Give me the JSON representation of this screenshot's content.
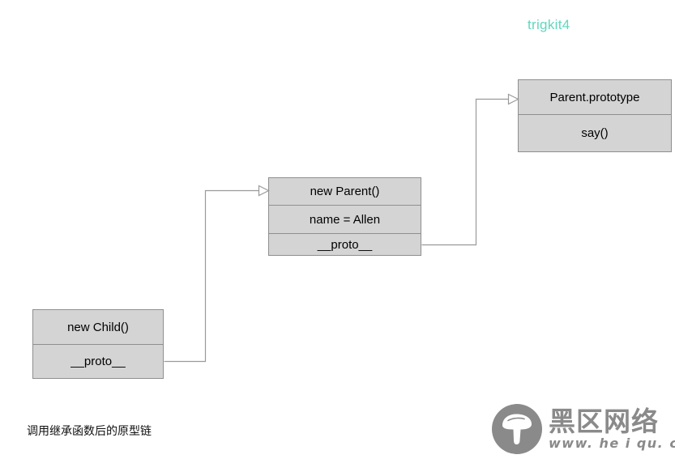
{
  "watermark_top": {
    "text": "trigkit4",
    "color": "#5fd8bd"
  },
  "diagram": {
    "type": "prototype-chain",
    "background": "#ffffff",
    "box_fill": "#d4d4d4",
    "box_border": "#8f8f8f",
    "connector_color": "#9a9a9a",
    "nodes": [
      {
        "id": "new-child",
        "title": "new Child()",
        "rows": [
          "new Child()",
          "__proto__"
        ]
      },
      {
        "id": "new-parent",
        "title": "new Parent()",
        "rows": [
          "new Parent()",
          "name = Allen",
          "__proto__"
        ]
      },
      {
        "id": "parent-prototype",
        "title": "Parent.prototype",
        "rows": [
          "Parent.prototype",
          "say()"
        ]
      }
    ],
    "edges": [
      {
        "from": "new-child.__proto__",
        "to": "new-parent",
        "arrow": "open-triangle"
      },
      {
        "from": "new-parent.__proto__",
        "to": "parent-prototype",
        "arrow": "open-triangle"
      }
    ]
  },
  "caption": {
    "text": "调用继承函数后的原型链"
  },
  "watermark_bottom": {
    "icon": "mushroom-icon",
    "cn_text": "黑区网络",
    "url_text": "www. he i qu. com",
    "color": "#8a8a8a"
  }
}
